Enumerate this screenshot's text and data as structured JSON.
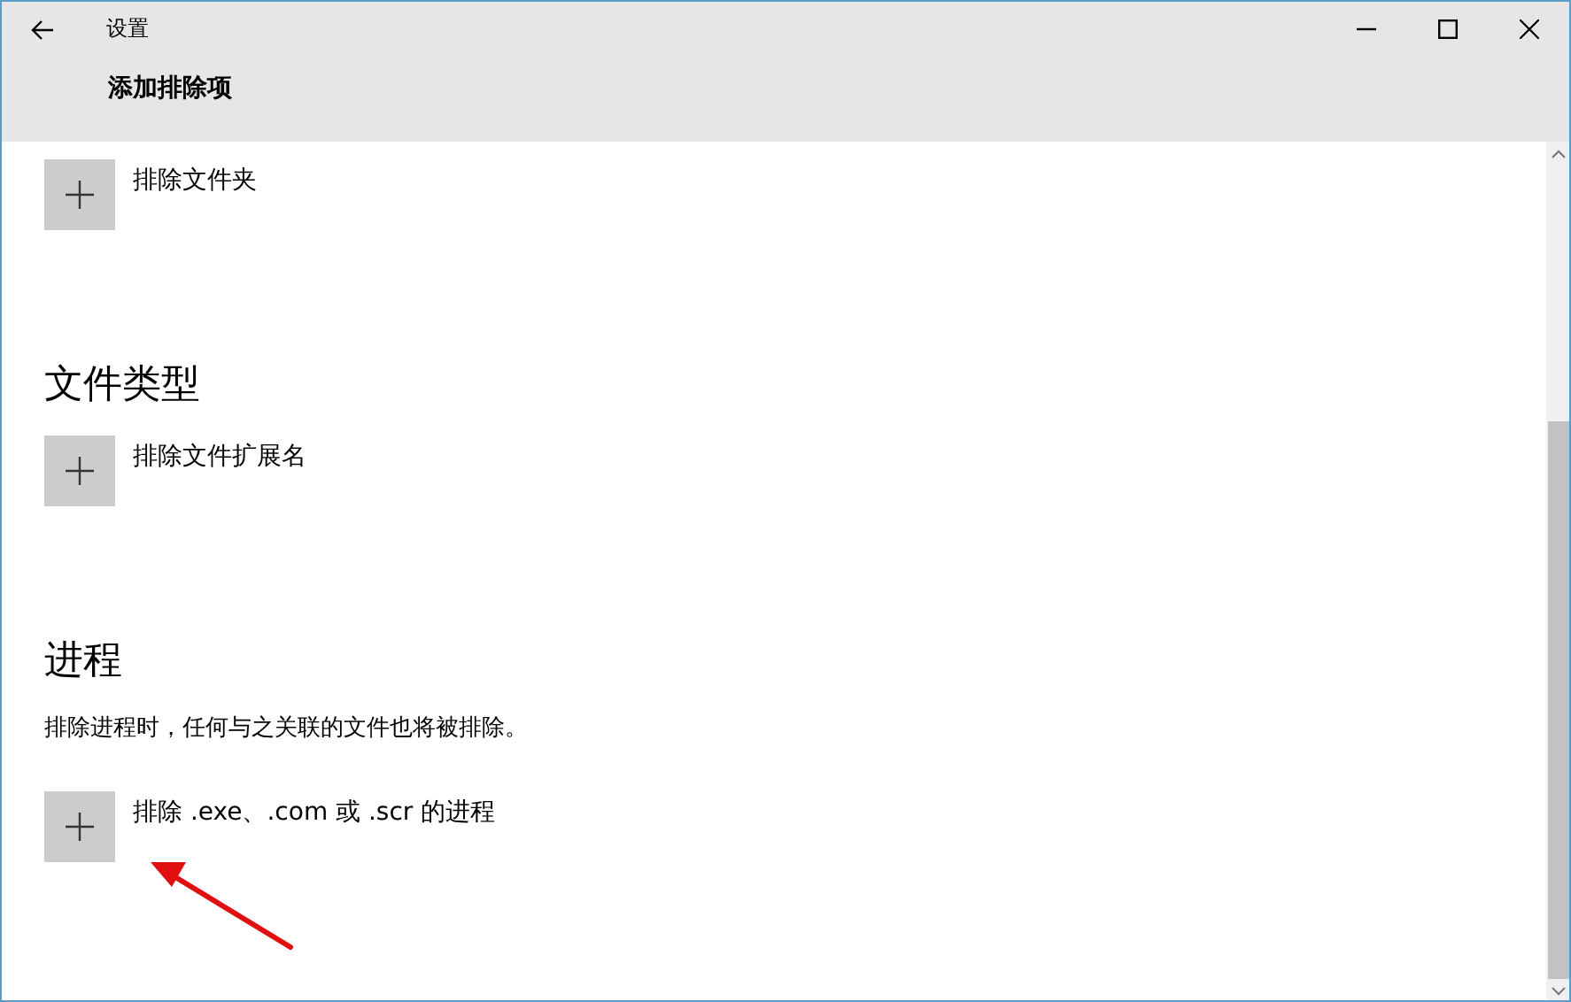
{
  "window": {
    "title": "设置"
  },
  "page_title": "添加排除项",
  "sections": [
    {
      "add_label": "排除文件夹"
    },
    {
      "heading": "文件类型",
      "add_label": "排除文件扩展名"
    },
    {
      "heading": "进程",
      "description": "排除进程时，任何与之关联的文件也将被排除。",
      "add_label": "排除 .exe、.com 或 .scr 的进程"
    }
  ]
}
